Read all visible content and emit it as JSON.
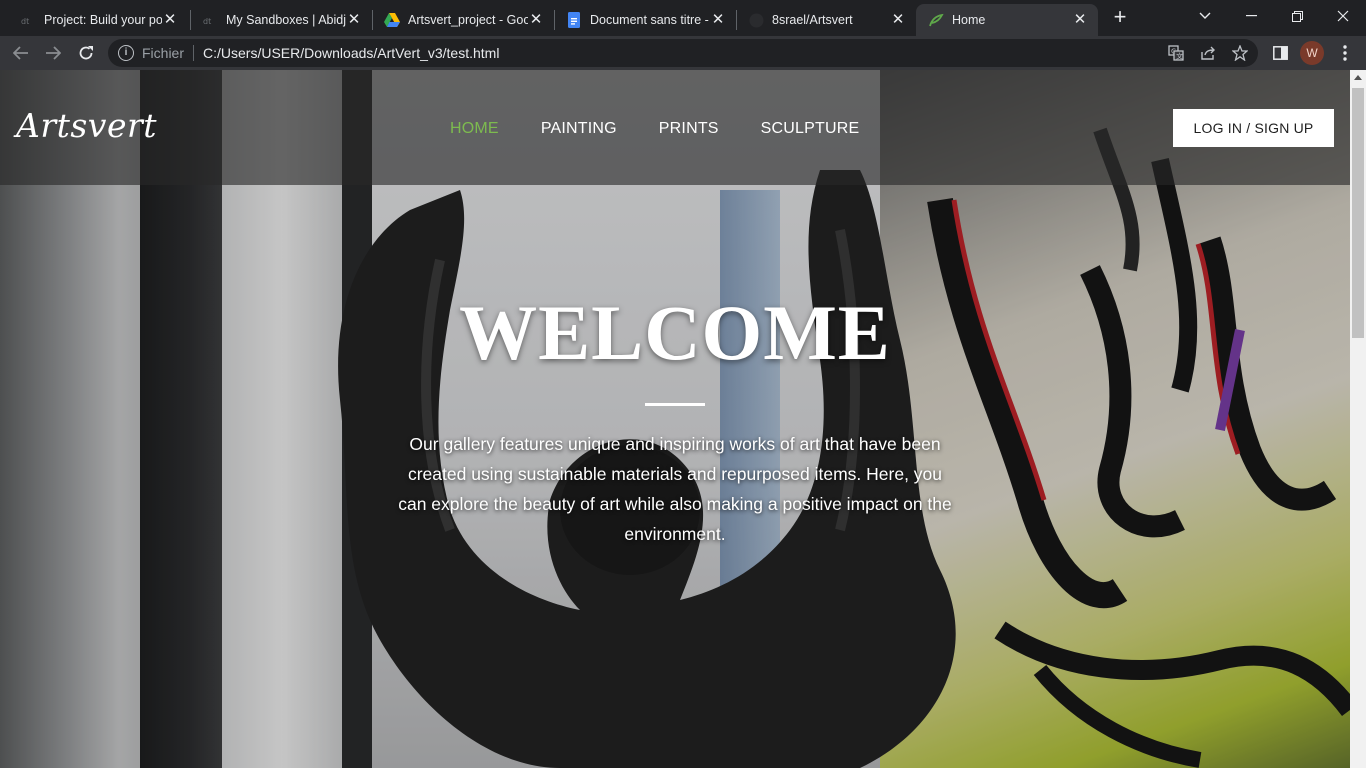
{
  "browser": {
    "tabs": [
      {
        "title": "Project: Build your por",
        "active": false
      },
      {
        "title": "My Sandboxes | Abidja",
        "active": false
      },
      {
        "title": "Artsvert_project - Goo",
        "active": false
      },
      {
        "title": "Document sans titre -",
        "active": false
      },
      {
        "title": "8srael/Artsvert",
        "active": false
      },
      {
        "title": "Home",
        "active": true
      }
    ],
    "new_tab": "+",
    "address": {
      "scheme": "Fichier",
      "url": "C:/Users/USER/Downloads/ArtVert_v3/test.html"
    },
    "profile_initial": "W",
    "icons": {
      "back": "arrow-left-icon",
      "forward": "arrow-right-icon",
      "reload": "reload-icon",
      "site_info": "info-icon",
      "translate": "translate-icon",
      "share": "share-icon",
      "bookmark": "star-icon",
      "side_panel": "side-panel-icon",
      "menu": "kebab-menu-icon"
    }
  },
  "site": {
    "logo": "Artsvert",
    "nav": [
      {
        "label": "HOME",
        "active": true
      },
      {
        "label": "PAINTING",
        "active": false
      },
      {
        "label": "PRINTS",
        "active": false
      },
      {
        "label": "SCULPTURE",
        "active": false
      }
    ],
    "login_label": "LOG IN / SIGN UP",
    "hero": {
      "title": "WELCOME",
      "text": "Our gallery features unique and inspiring works of art that have been created using sustainable materials and repurposed items. Here, you can explore the beauty of art while also making a positive impact on the environment."
    },
    "colors": {
      "nav_active": "#7dbb4f",
      "header_overlay": "rgba(40,40,40,0.62)",
      "button_bg": "#ffffff"
    }
  }
}
